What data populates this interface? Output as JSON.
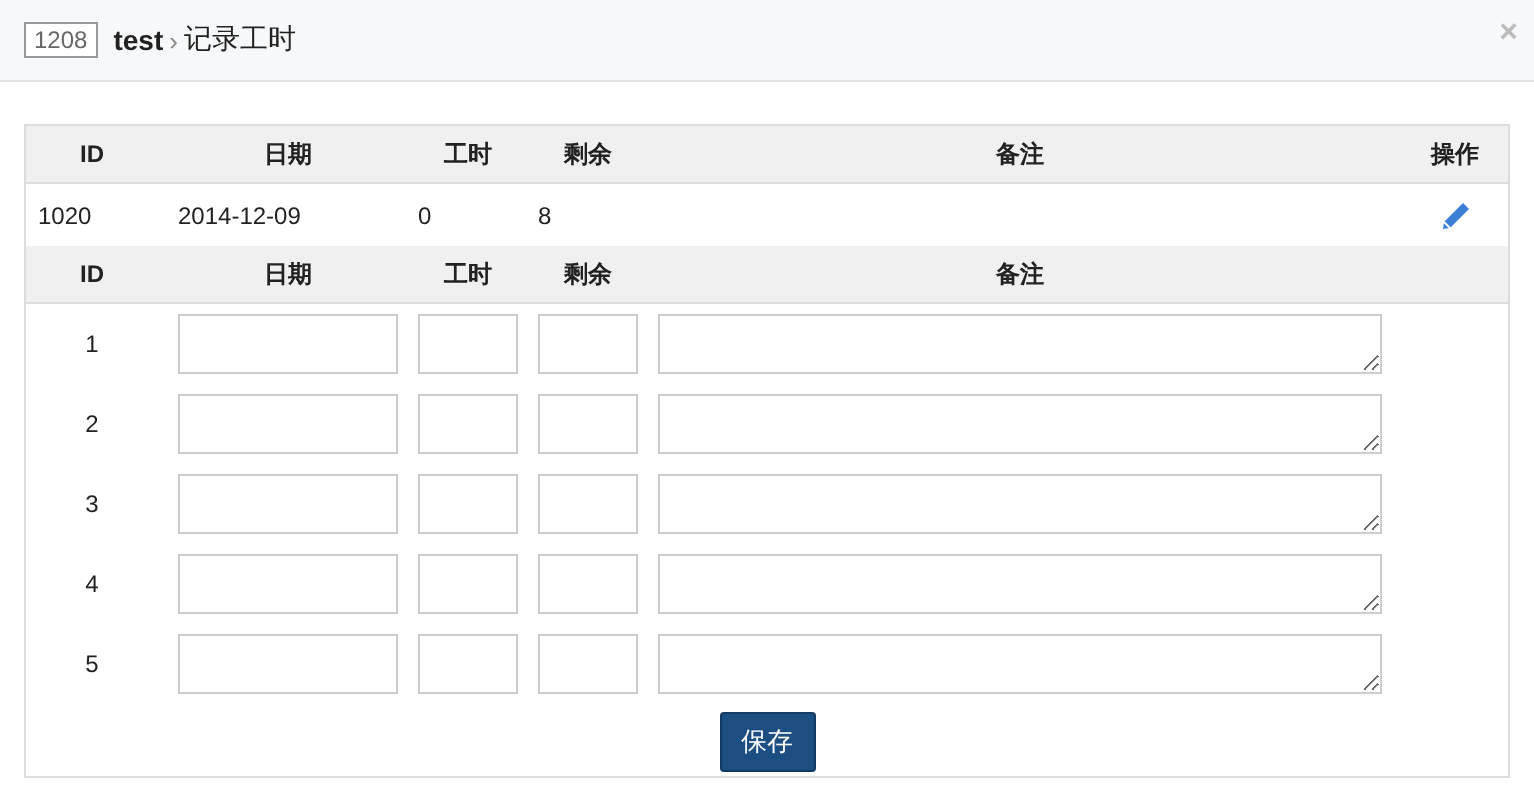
{
  "header": {
    "id_badge": "1208",
    "project": "test",
    "separator": "›",
    "title": "记录工时",
    "close": "×"
  },
  "records": {
    "columns": [
      "ID",
      "日期",
      "工时",
      "剩余",
      "备注",
      "操作"
    ],
    "rows": [
      {
        "id": "1020",
        "date": "2014-12-09",
        "hours": "0",
        "remaining": "8",
        "note": ""
      }
    ]
  },
  "entry": {
    "columns": [
      "ID",
      "日期",
      "工时",
      "剩余",
      "备注"
    ],
    "rows": [
      {
        "id": "1"
      },
      {
        "id": "2"
      },
      {
        "id": "3"
      },
      {
        "id": "4"
      },
      {
        "id": "5"
      }
    ],
    "save_button": "保存"
  }
}
